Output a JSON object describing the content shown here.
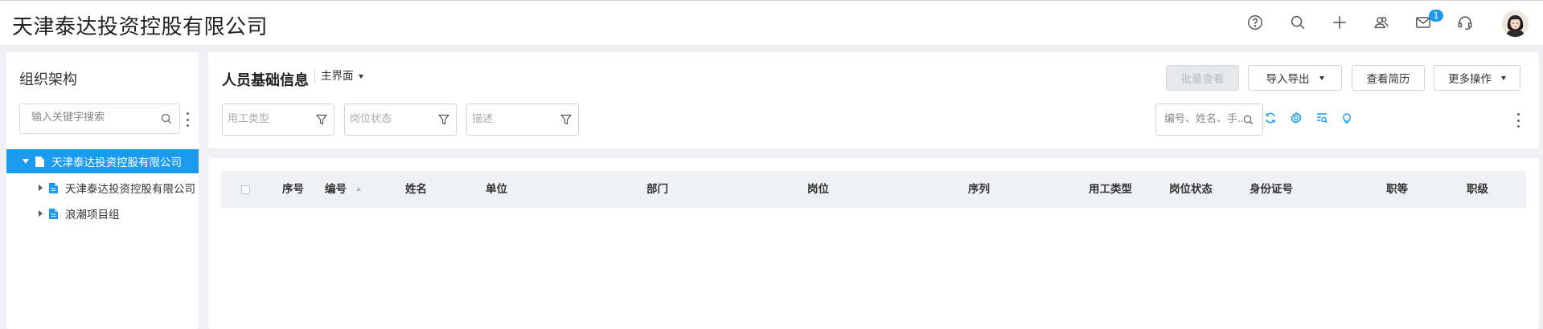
{
  "header": {
    "company_name": "天津泰达投资控股有限公司",
    "icons": [
      "help-icon",
      "search-icon",
      "plus-icon",
      "contacts-icon",
      "mail-icon",
      "headset-icon"
    ],
    "mail_badge": "1"
  },
  "sidebar": {
    "title": "组织架构",
    "search_placeholder": "输入关键字搜索",
    "tree": [
      {
        "label": "天津泰达投资控股有限公司",
        "level": 0,
        "expanded": true,
        "selected": true
      },
      {
        "label": "天津泰达投资控股有限公司",
        "level": 1,
        "expanded": false,
        "selected": false
      },
      {
        "label": "浪潮项目组",
        "level": 1,
        "expanded": false,
        "selected": false
      }
    ]
  },
  "main": {
    "title": "人员基础信息",
    "view_label": "主界面",
    "buttons": {
      "batch_view": "批量查看",
      "import_export": "导入导出",
      "view_resume": "查看简历",
      "more_actions": "更多操作"
    },
    "filters": {
      "employment_type_placeholder": "用工类型",
      "position_status_placeholder": "岗位状态",
      "description_placeholder": "描述"
    },
    "toolbar_icons": [
      "refresh-icon",
      "settings-icon",
      "column-filter-icon",
      "bulb-icon"
    ],
    "keyword_search_placeholder": "编号、姓名、手..."
  },
  "table": {
    "columns": [
      "序号",
      "编号",
      "姓名",
      "单位",
      "部门",
      "岗位",
      "序列",
      "用工类型",
      "岗位状态",
      "身份证号",
      "职等",
      "职级"
    ],
    "rows": []
  },
  "colors": {
    "accent": "#1a9bf0",
    "background": "#eef0f4",
    "table_header": "#f0f1f4"
  }
}
